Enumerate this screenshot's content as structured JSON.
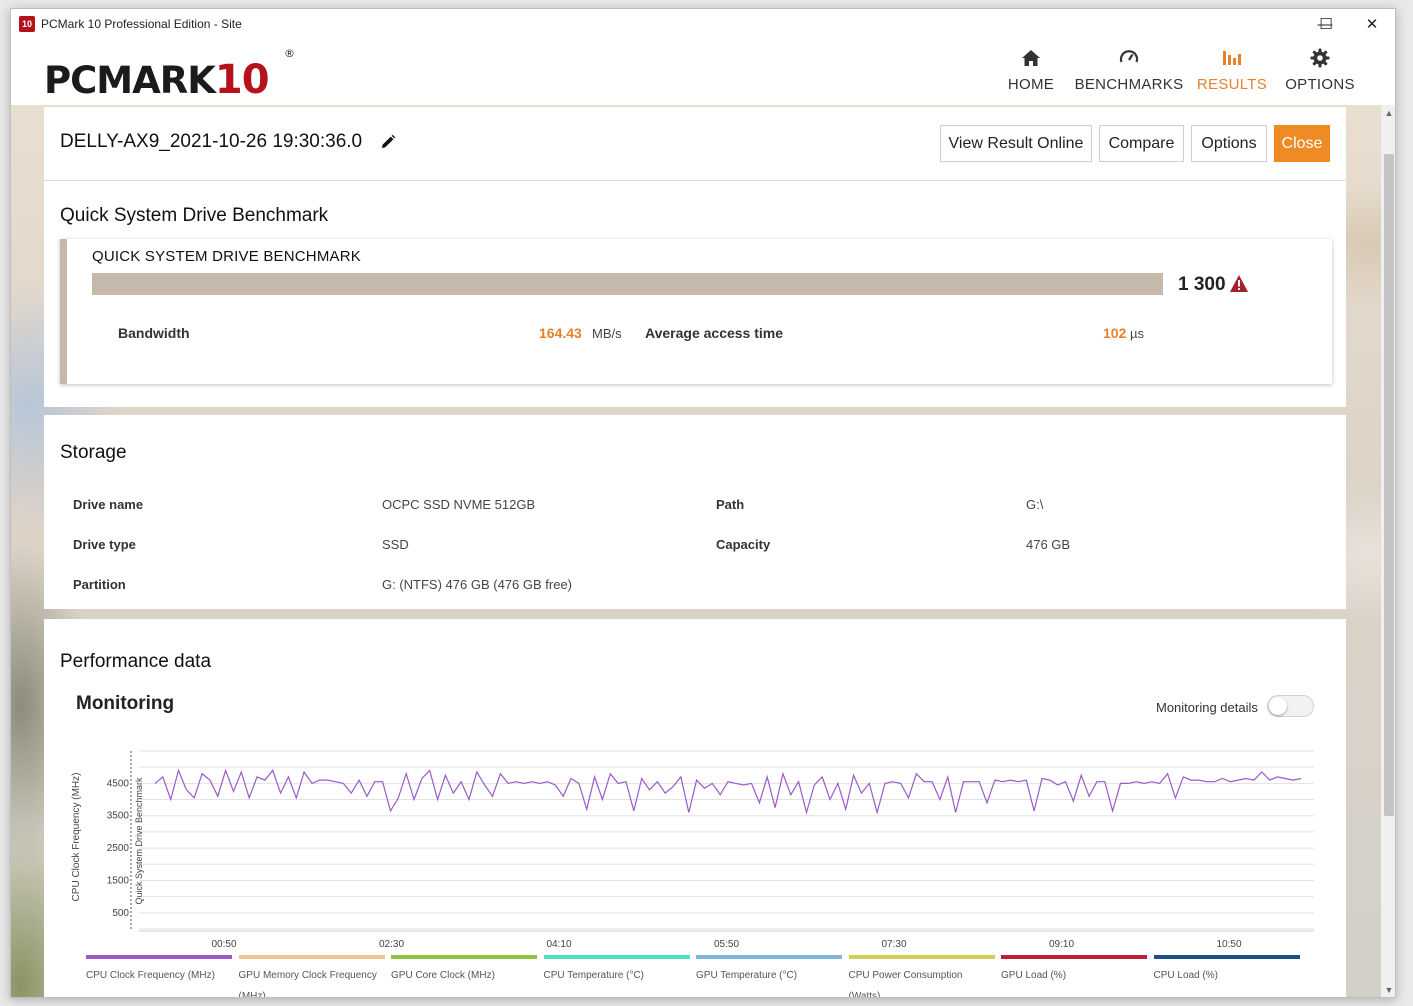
{
  "window": {
    "title": "PCMark 10 Professional Edition - Site",
    "icon_text": "10",
    "controls": {
      "minimize": "—",
      "maximize": "☐",
      "close": "✕"
    }
  },
  "header": {
    "logo_text": "PCMARK",
    "logo_number": "10",
    "logo_mark": "®",
    "nav": [
      {
        "label": "HOME",
        "icon": "home-icon",
        "active": false
      },
      {
        "label": "BENCHMARKS",
        "icon": "gauge-icon",
        "active": false
      },
      {
        "label": "RESULTS",
        "icon": "bar-chart-icon",
        "active": true
      },
      {
        "label": "OPTIONS",
        "icon": "gear-icon",
        "active": false
      }
    ]
  },
  "result": {
    "title": "DELLY-AX9_2021-10-26 19:30:36.0",
    "buttons": {
      "view_online": "View Result Online",
      "compare": "Compare",
      "options": "Options",
      "close": "Close"
    }
  },
  "benchmark": {
    "section_title": "Quick System Drive Benchmark",
    "name": "QUICK SYSTEM DRIVE BENCHMARK",
    "score": "1 300",
    "bandwidth_label": "Bandwidth",
    "bandwidth_value": "164.43",
    "bandwidth_unit": "MB/s",
    "access_label": "Average access time",
    "access_value": "102",
    "access_unit": "µs"
  },
  "storage": {
    "section_title": "Storage",
    "rows": [
      {
        "label": "Drive name",
        "value": "OCPC SSD NVME 512GB"
      },
      {
        "label": "Path",
        "value": "G:\\"
      },
      {
        "label": "Drive type",
        "value": "SSD"
      },
      {
        "label": "Capacity",
        "value": "476 GB"
      },
      {
        "label": "Partition",
        "value": "G: (NTFS) 476 GB (476 GB free)"
      }
    ]
  },
  "performance": {
    "section_title": "Performance data",
    "monitoring_title": "Monitoring",
    "toggle_label": "Monitoring details",
    "toggle_on": false
  },
  "colors": {
    "accent": "#e8802c",
    "close_button": "#f08a24",
    "bench_bar": "#c7b9aa",
    "series_line": "#9b59c9"
  },
  "chart_data": {
    "type": "line",
    "ylabel": "CPU Clock Frequency (MHz)",
    "marker_label": "Quick System Drive Benchmark",
    "x_ticks": [
      "00:50",
      "02:30",
      "04:10",
      "05:50",
      "07:30",
      "09:10",
      "10:50"
    ],
    "y_ticks": [
      500,
      1500,
      2500,
      3500,
      4500
    ],
    "ylim": [
      0,
      5500
    ],
    "grid": true,
    "series": [
      {
        "name": "CPU Clock Frequency (MHz)",
        "color": "#9b59c9",
        "values": [
          4500,
          4700,
          4000,
          4900,
          4300,
          4050,
          4800,
          4600,
          4100,
          4900,
          4250,
          4850,
          4050,
          4700,
          4600,
          4900,
          4200,
          4700,
          4050,
          4850,
          4500,
          4600,
          4600,
          4550,
          4500,
          4200,
          4600,
          4100,
          4550,
          4550,
          3650,
          4050,
          4800,
          4000,
          4650,
          4900,
          4000,
          4750,
          4200,
          4550,
          4000,
          4850,
          4450,
          4100,
          4800,
          4500,
          4550,
          4500,
          4550,
          4500,
          4550,
          4450,
          4100,
          4650,
          4500,
          3700,
          4700,
          4000,
          4800,
          4500,
          4550,
          3650,
          4650,
          4300,
          4550,
          4200,
          4400,
          4700,
          3600,
          4600,
          4350,
          4500,
          4150,
          4550,
          4500,
          4450,
          4500,
          3900,
          4700,
          3750,
          4800,
          4150,
          4550,
          3600,
          4450,
          4700,
          4000,
          4500,
          3700,
          4750,
          4200,
          4500,
          3600,
          4500,
          4550,
          4500,
          4050,
          4800,
          4550,
          4550,
          4000,
          4700,
          3600,
          4550,
          4550,
          4550,
          3900,
          4600,
          4550,
          4600,
          4550,
          4600,
          3650,
          4650,
          4600,
          4450,
          4550,
          3950,
          4750,
          4100,
          4550,
          4550,
          3650,
          4500,
          4500,
          4550,
          4500,
          4550,
          4500,
          4800,
          4050,
          4700,
          4600,
          4600,
          4550,
          4550,
          4650,
          4550,
          4600,
          4650,
          4600,
          4850,
          4600,
          4700,
          4650,
          4600,
          4650
        ]
      }
    ],
    "legend": [
      {
        "name": "CPU Clock Frequency (MHz)",
        "color": "#9b59c9"
      },
      {
        "name": "GPU Memory Clock Frequency (MHz)",
        "color": "#e9c98f"
      },
      {
        "name": "GPU Core Clock (MHz)",
        "color": "#8cc63f"
      },
      {
        "name": "CPU Temperature (°C)",
        "color": "#4fe0c0"
      },
      {
        "name": "GPU Temperature (°C)",
        "color": "#7fb6e0"
      },
      {
        "name": "CPU Power Consumption (Watts)",
        "color": "#d2cd52"
      },
      {
        "name": "GPU Load (%)",
        "color": "#c21c34"
      },
      {
        "name": "CPU Load (%)",
        "color": "#1d4f86"
      }
    ]
  }
}
